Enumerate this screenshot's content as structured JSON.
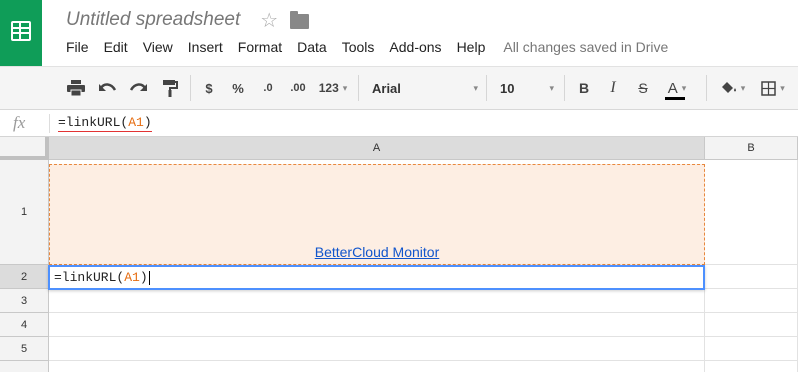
{
  "app": {
    "doc_title": "Untitled spreadsheet",
    "star_icon": "☆",
    "menu": [
      "File",
      "Edit",
      "View",
      "Insert",
      "Format",
      "Data",
      "Tools",
      "Add-ons",
      "Help"
    ],
    "save_status": "All changes saved in Drive"
  },
  "toolbar": {
    "currency": "$",
    "percent": "%",
    "decrease_decimals": ".0",
    "increase_decimals": ".00",
    "more_formats": "123",
    "font": "Arial",
    "font_size": "10",
    "bold": "B",
    "italic": "I",
    "strikethrough": "S",
    "text_color": "A",
    "caret": "▾"
  },
  "formula_bar": {
    "fx_label": "fx",
    "prefix": "=linkURL(",
    "ref": "A1",
    "suffix": ")"
  },
  "grid": {
    "columns": [
      "A",
      "B"
    ],
    "rows": [
      "1",
      "2",
      "3",
      "4",
      "5"
    ],
    "cell_A1_text": "BetterCloud Monitor",
    "cell_A2_prefix": "=linkURL(",
    "cell_A2_ref": "A1",
    "cell_A2_suffix": ")"
  },
  "colors": {
    "brand_green": "#0f9d58",
    "reference_orange": "#e66e13",
    "selection_blue": "#4d90fe",
    "link_blue": "#1155cc",
    "a1_fill": "#fdeee3"
  }
}
